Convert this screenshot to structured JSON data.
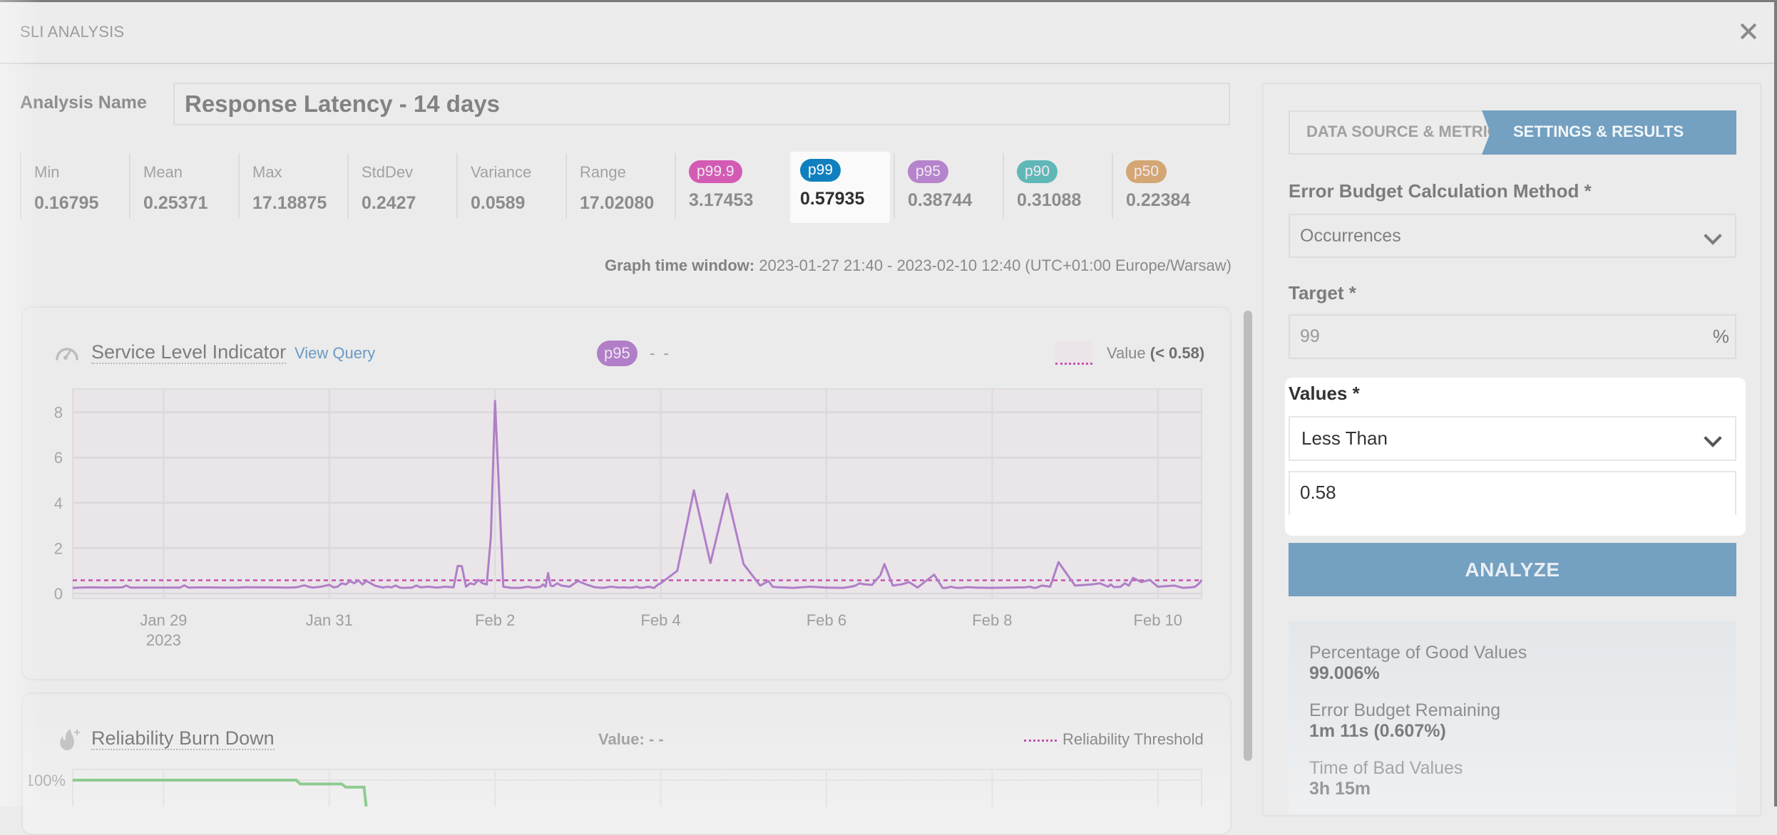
{
  "modal": {
    "title": "SLI ANALYSIS",
    "close_icon": "close-x-icon"
  },
  "analysis_name": {
    "label": "Analysis Name",
    "value": "Response Latency - 14 days"
  },
  "stats": [
    {
      "label": "Min",
      "value": "0.16795"
    },
    {
      "label": "Mean",
      "value": "0.25371"
    },
    {
      "label": "Max",
      "value": "17.18875"
    },
    {
      "label": "StdDev",
      "value": "0.2427"
    },
    {
      "label": "Variance",
      "value": "0.0589"
    },
    {
      "label": "Range",
      "value": "17.02080"
    }
  ],
  "percentiles": [
    {
      "label": "p99.9",
      "value": "3.17453",
      "color": "#d35bb4",
      "highlighted": false
    },
    {
      "label": "p99",
      "value": "0.57935",
      "color": "#0f80bd",
      "highlighted": true
    },
    {
      "label": "p95",
      "value": "0.38744",
      "color": "#b584cc",
      "highlighted": false
    },
    {
      "label": "p90",
      "value": "0.31088",
      "color": "#5fb8b7",
      "highlighted": false
    },
    {
      "label": "p50",
      "value": "0.22384",
      "color": "#d3a673",
      "highlighted": false
    }
  ],
  "time_window": {
    "label": "Graph time window:",
    "value": "2023-01-27 21:40 - 2023-02-10 12:40 (UTC+01:00 Europe/Warsaw)"
  },
  "sli_card": {
    "icon": "gauge-icon",
    "title": "Service Level Indicator",
    "view_query": "View Query",
    "selected_percentile": "p95",
    "hover_value": "- -",
    "legend_label": "Value",
    "legend_condition": "(< 0.58)"
  },
  "burn_card": {
    "icon": "flame-icon",
    "title": "Reliability Burn Down",
    "value_label": "Value:",
    "value": "- -",
    "legend": "Reliability Threshold",
    "y_tick_top": "100%"
  },
  "right_panel": {
    "steps": [
      {
        "label": "DATA SOURCE & METRIC",
        "active": false
      },
      {
        "label": "SETTINGS & RESULTS",
        "active": true
      }
    ],
    "method": {
      "label": "Error Budget Calculation Method",
      "required": "*",
      "value": "Occurrences"
    },
    "target": {
      "label": "Target",
      "required": "*",
      "value": "99",
      "unit": "%"
    },
    "values": {
      "label": "Values",
      "required": "*",
      "operator": "Less Than",
      "threshold": "0.58"
    },
    "analyze_button": "ANALYZE",
    "results": [
      {
        "label": "Percentage of Good Values",
        "value": "99.006%"
      },
      {
        "label": "Error Budget Remaining",
        "value": "1m 11s (0.607%)"
      },
      {
        "label": "Time of Bad Values",
        "value": "3h 15m"
      }
    ]
  },
  "chart_data": [
    {
      "type": "line",
      "title": "Service Level Indicator",
      "xlabel": "",
      "ylabel": "",
      "x_range": [
        "2023-01-27T21:40",
        "2023-02-10T12:40"
      ],
      "ylim": [
        0,
        8.9
      ],
      "y_ticks": [
        0,
        2,
        4,
        6,
        8
      ],
      "x_ticks": [
        "Jan 29\n2023",
        "Jan 31",
        "Feb 2",
        "Feb 4",
        "Feb 6",
        "Feb 8",
        "Feb 10"
      ],
      "x_tick_dates": [
        "2023-01-29",
        "2023-01-31",
        "2023-02-02",
        "2023-02-04",
        "2023-02-06",
        "2023-02-08",
        "2023-02-10"
      ],
      "grid": true,
      "threshold": {
        "value": 0.58,
        "style": "dashed",
        "color": "#c453b0"
      },
      "series": [
        {
          "name": "p95",
          "color": "#b07fc8",
          "x_days_from_jan29": [
            -1.097,
            -0.9,
            -0.7,
            -0.5,
            -0.45,
            -0.4,
            -0.2,
            0.0,
            0.2,
            0.25,
            0.3,
            0.5,
            0.7,
            0.9,
            1.0,
            1.05,
            1.1,
            1.3,
            1.5,
            1.6,
            1.7,
            1.75,
            1.8,
            1.9,
            2.0,
            2.05,
            2.1,
            2.15,
            2.2,
            2.25,
            2.3,
            2.35,
            2.4,
            2.45,
            2.5,
            2.55,
            2.6,
            2.65,
            2.7,
            2.75,
            2.8,
            2.85,
            2.9,
            3.0,
            3.05,
            3.1,
            3.2,
            3.3,
            3.4,
            3.5,
            3.55,
            3.6,
            3.65,
            3.7,
            3.75,
            3.8,
            3.85,
            3.9,
            3.95,
            4.0,
            4.1,
            4.2,
            4.3,
            4.4,
            4.45,
            4.5,
            4.55,
            4.58,
            4.61,
            4.64,
            4.67,
            4.7,
            4.75,
            4.8,
            4.9,
            5.0,
            5.1,
            5.2,
            5.3,
            5.4,
            5.5,
            5.55,
            5.6,
            5.65,
            5.71,
            5.75,
            5.8,
            5.85,
            5.92,
            5.97,
            6.0,
            6.2,
            6.4,
            6.6,
            6.8,
            7.0,
            7.2,
            7.3,
            7.35,
            7.4,
            7.6,
            7.8,
            8.0,
            8.2,
            8.3,
            8.35,
            8.4,
            8.43,
            8.47,
            8.55,
            8.6,
            8.65,
            8.7,
            8.8,
            8.9,
            9.0,
            9.1,
            9.2,
            9.3,
            9.4,
            9.45,
            9.5,
            9.55,
            9.58,
            9.62,
            9.7,
            9.8,
            10.0,
            10.2,
            10.4,
            10.45,
            10.5,
            10.54,
            10.6,
            10.7,
            10.8,
            11.0,
            11.2,
            11.3,
            11.4,
            11.43,
            11.47,
            11.55,
            11.6,
            11.65,
            11.7,
            11.8,
            11.9,
            12.0,
            12.2,
            12.3,
            12.4,
            12.45,
            12.5,
            12.528
          ],
          "values": [
            0.25,
            0.27,
            0.26,
            0.27,
            0.35,
            0.26,
            0.26,
            0.26,
            0.26,
            0.36,
            0.26,
            0.27,
            0.26,
            0.26,
            0.28,
            0.27,
            0.27,
            0.27,
            0.26,
            0.27,
            0.36,
            0.3,
            0.26,
            0.3,
            0.38,
            0.27,
            0.3,
            0.45,
            0.4,
            0.55,
            0.45,
            0.58,
            0.4,
            0.55,
            0.45,
            0.35,
            0.3,
            0.26,
            0.3,
            0.27,
            0.35,
            0.26,
            0.25,
            0.26,
            0.35,
            0.27,
            0.3,
            0.26,
            0.3,
            0.27,
            1.22,
            1.2,
            0.3,
            0.45,
            0.4,
            0.6,
            0.45,
            0.4,
            2.5,
            8.5,
            0.3,
            0.25,
            0.25,
            0.3,
            0.26,
            0.26,
            0.3,
            0.4,
            0.3,
            0.9,
            0.35,
            0.32,
            0.45,
            0.35,
            0.3,
            0.55,
            0.4,
            0.28,
            0.25,
            0.3,
            0.26,
            0.27,
            0.26,
            0.26,
            0.3,
            0.25,
            0.26,
            0.3,
            0.25,
            0.4,
            0.45,
            1.0,
            4.55,
            1.35,
            4.4,
            1.3,
            0.35,
            0.55,
            0.3,
            0.28,
            0.25,
            0.3,
            0.26,
            0.25,
            0.3,
            0.35,
            0.45,
            0.42,
            0.4,
            0.38,
            0.6,
            0.8,
            1.3,
            0.35,
            0.4,
            0.5,
            0.26,
            0.55,
            0.83,
            0.25,
            0.25,
            0.3,
            0.26,
            0.25,
            0.25,
            0.28,
            0.26,
            0.25,
            0.26,
            0.27,
            0.3,
            0.25,
            0.26,
            0.35,
            0.3,
            1.38,
            0.35,
            0.4,
            0.45,
            0.3,
            0.4,
            0.28,
            0.3,
            0.45,
            0.35,
            0.69,
            0.5,
            0.6,
            0.3,
            0.35,
            0.25,
            0.27,
            0.3,
            0.45,
            0.6,
            0.72,
            0.35,
            0.45,
            0.25,
            0.28,
            0.35,
            0.3,
            0.4,
            0.55,
            0.3,
            1.7,
            0.35,
            0.4,
            0.75,
            0.45,
            0.55,
            0.3,
            0.26,
            0.25,
            0.28,
            0.32,
            0.4,
            0.5,
            0.65
          ]
        }
      ]
    },
    {
      "type": "line",
      "title": "Reliability Burn Down",
      "y_ticks": [
        "100%"
      ],
      "grid": true,
      "series": [
        {
          "name": "Reliability",
          "color": "#8fcb92",
          "x_days_from_jan29": [
            -1.097,
            1.6,
            1.65,
            2.15,
            2.2,
            2.42,
            2.47
          ],
          "values_percent": [
            100,
            100,
            99.4,
            99.4,
            98.9,
            98.9,
            92
          ]
        }
      ],
      "threshold_legend": "Reliability Threshold"
    }
  ]
}
